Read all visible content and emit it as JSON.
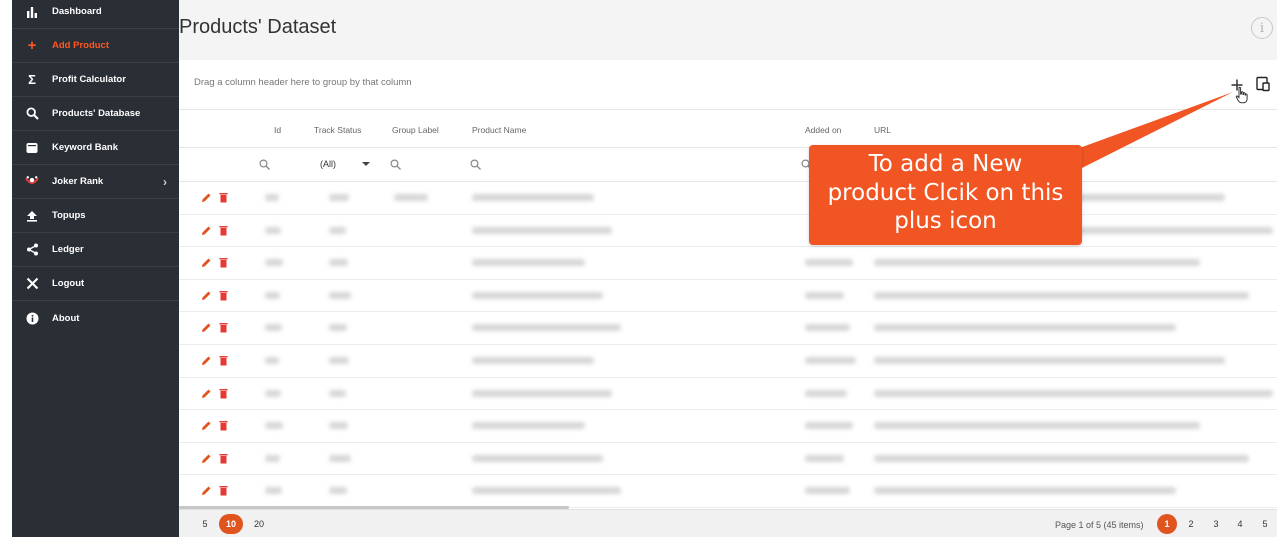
{
  "sidebar": {
    "items": [
      {
        "label": "Dashboard",
        "icon": "bar-chart-icon"
      },
      {
        "label": "Add Product",
        "icon": "plus-icon"
      },
      {
        "label": "Profit Calculator",
        "icon": "sigma-icon"
      },
      {
        "label": "Products' Database",
        "icon": "search-icon"
      },
      {
        "label": "Keyword Bank",
        "icon": "bank-icon"
      },
      {
        "label": "Joker Rank",
        "icon": "joker-icon"
      },
      {
        "label": "Topups",
        "icon": "upload-icon"
      },
      {
        "label": "Ledger",
        "icon": "share-icon"
      },
      {
        "label": "Logout",
        "icon": "close-icon"
      },
      {
        "label": "About",
        "icon": "info-icon"
      }
    ],
    "active_color": "#ff5722",
    "background": "#2a2e35"
  },
  "page": {
    "title": "Products' Dataset",
    "info_icon": "info-icon"
  },
  "grid": {
    "group_hint": "Drag a column header here to group by that column",
    "columns": [
      "Id",
      "Track Status",
      "Group Label",
      "Product Name",
      "Added on",
      "URL"
    ],
    "filter_all": "(All)",
    "row_count_visible": 10
  },
  "pager": {
    "page_sizes": [
      "5",
      "10",
      "20"
    ],
    "active_page_size": "10",
    "info": "Page 1 of 5 (45 items)",
    "pages": [
      "1",
      "2",
      "3",
      "4",
      "5"
    ],
    "active_page": "1",
    "accent": "#e0541f"
  },
  "callout": {
    "lines": [
      "To add a New",
      "product Clcik on this",
      "plus icon"
    ],
    "color": "#f05523"
  }
}
